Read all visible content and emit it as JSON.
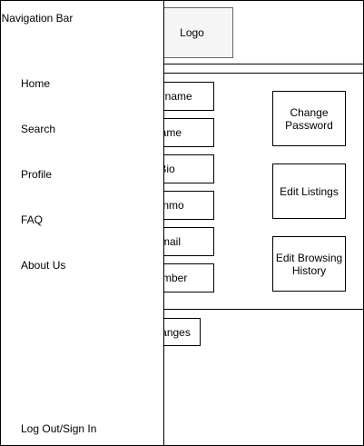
{
  "header": {
    "logo_label": "Logo"
  },
  "profile_fields": [
    {
      "label": "Username"
    },
    {
      "label": "Name"
    },
    {
      "label": "Bio"
    },
    {
      "label": "Venmo"
    },
    {
      "label": "Email"
    },
    {
      "label": "Phone Number"
    }
  ],
  "actions": {
    "change_password": "Change Password",
    "edit_listings": "Edit Listings",
    "edit_browsing_history": "Edit Browsing History"
  },
  "footer": {
    "save_label": "Save Changes"
  },
  "sidebar": {
    "title": "Navigation Bar",
    "items": [
      {
        "label": "Home"
      },
      {
        "label": "Search"
      },
      {
        "label": "Profile"
      },
      {
        "label": "FAQ"
      },
      {
        "label": "About Us"
      }
    ],
    "auth_label": "Log Out/Sign In"
  }
}
